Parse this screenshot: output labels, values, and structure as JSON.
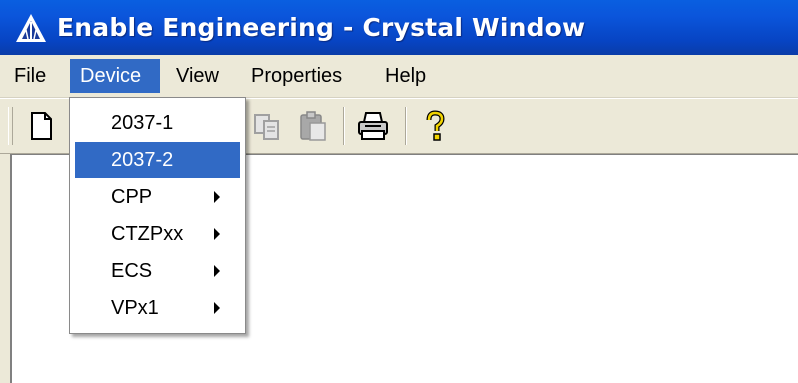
{
  "window": {
    "title": "Enable Engineering - Crystal Window",
    "icon": "triangle-logo-icon"
  },
  "menubar": {
    "items": [
      {
        "label": "File"
      },
      {
        "label": "Device",
        "active": true
      },
      {
        "label": "View"
      },
      {
        "label": "Properties"
      },
      {
        "label": "Help"
      }
    ]
  },
  "toolbar": {
    "buttons": [
      "new-document-icon",
      "copy-icon",
      "paste-icon",
      "print-icon",
      "help-icon"
    ]
  },
  "device_menu": {
    "items": [
      {
        "label": "2037-1",
        "submenu": false
      },
      {
        "label": "2037-2",
        "submenu": false,
        "selected": true
      },
      {
        "label": "CPP",
        "submenu": true
      },
      {
        "label": "CTZPxx",
        "submenu": true
      },
      {
        "label": "ECS",
        "submenu": true
      },
      {
        "label": "VPx1",
        "submenu": true
      }
    ]
  },
  "colors": {
    "titlebar": "#0a55db",
    "highlight": "#316ac5",
    "chrome": "#ece9d8"
  }
}
